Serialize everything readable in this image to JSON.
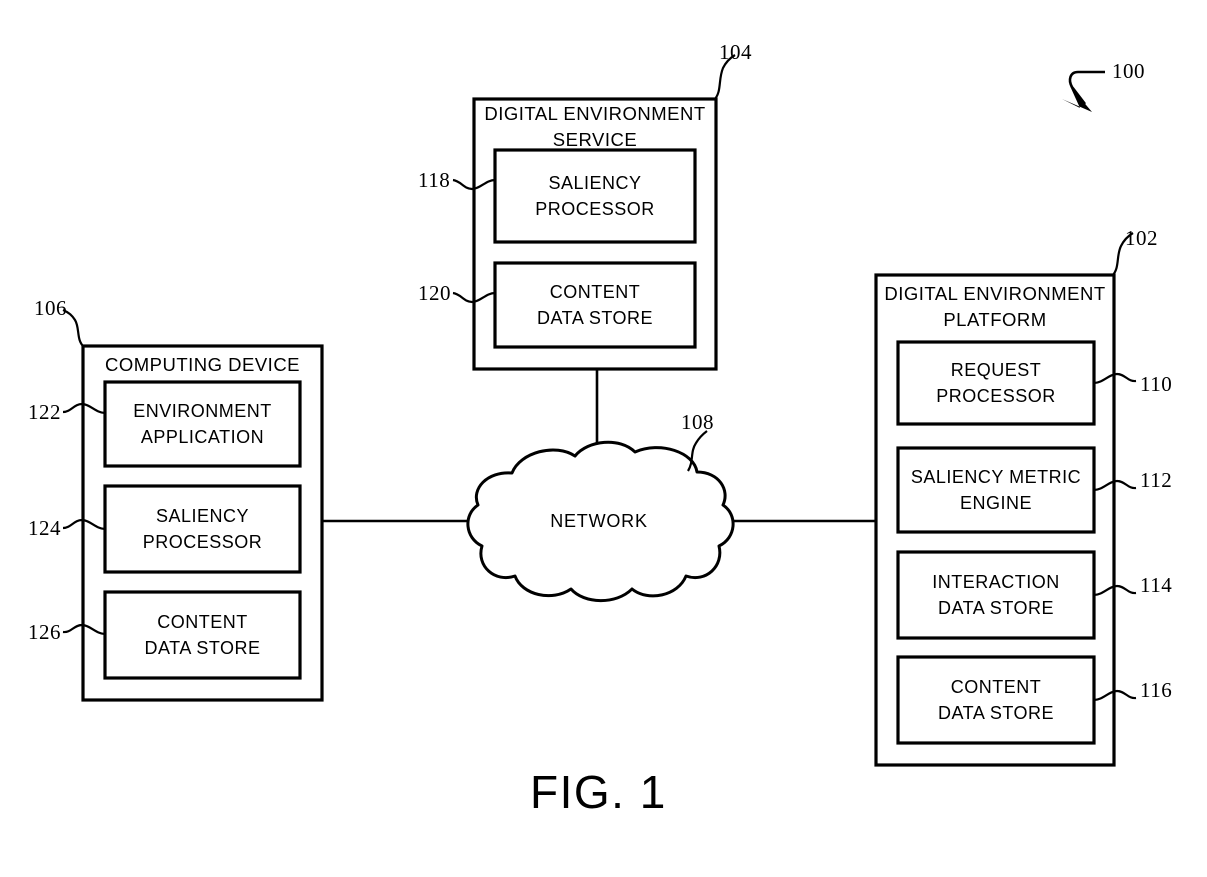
{
  "figure": {
    "caption": "FIG. 1",
    "system_ref": "100"
  },
  "nodes": {
    "digital_environment_service": {
      "ref": "104",
      "title": "DIGITAL ENVIRONMENT\nSERVICE",
      "components": [
        {
          "ref": "118",
          "label": "SALIENCY\nPROCESSOR"
        },
        {
          "ref": "120",
          "label": "CONTENT\nDATA STORE"
        }
      ]
    },
    "computing_device": {
      "ref": "106",
      "title": "COMPUTING DEVICE",
      "components": [
        {
          "ref": "122",
          "label": "ENVIRONMENT\nAPPLICATION"
        },
        {
          "ref": "124",
          "label": "SALIENCY\nPROCESSOR"
        },
        {
          "ref": "126",
          "label": "CONTENT\nDATA STORE"
        }
      ]
    },
    "digital_environment_platform": {
      "ref": "102",
      "title": "DIGITAL ENVIRONMENT\nPLATFORM",
      "components": [
        {
          "ref": "110",
          "label": "REQUEST\nPROCESSOR"
        },
        {
          "ref": "112",
          "label": "SALIENCY METRIC\nENGINE"
        },
        {
          "ref": "114",
          "label": "INTERACTION\nDATA STORE"
        },
        {
          "ref": "116",
          "label": "CONTENT\nDATA STORE"
        }
      ]
    },
    "network": {
      "ref": "108",
      "label": "NETWORK"
    }
  },
  "colors": {
    "stroke": "#000000",
    "background": "#ffffff"
  }
}
